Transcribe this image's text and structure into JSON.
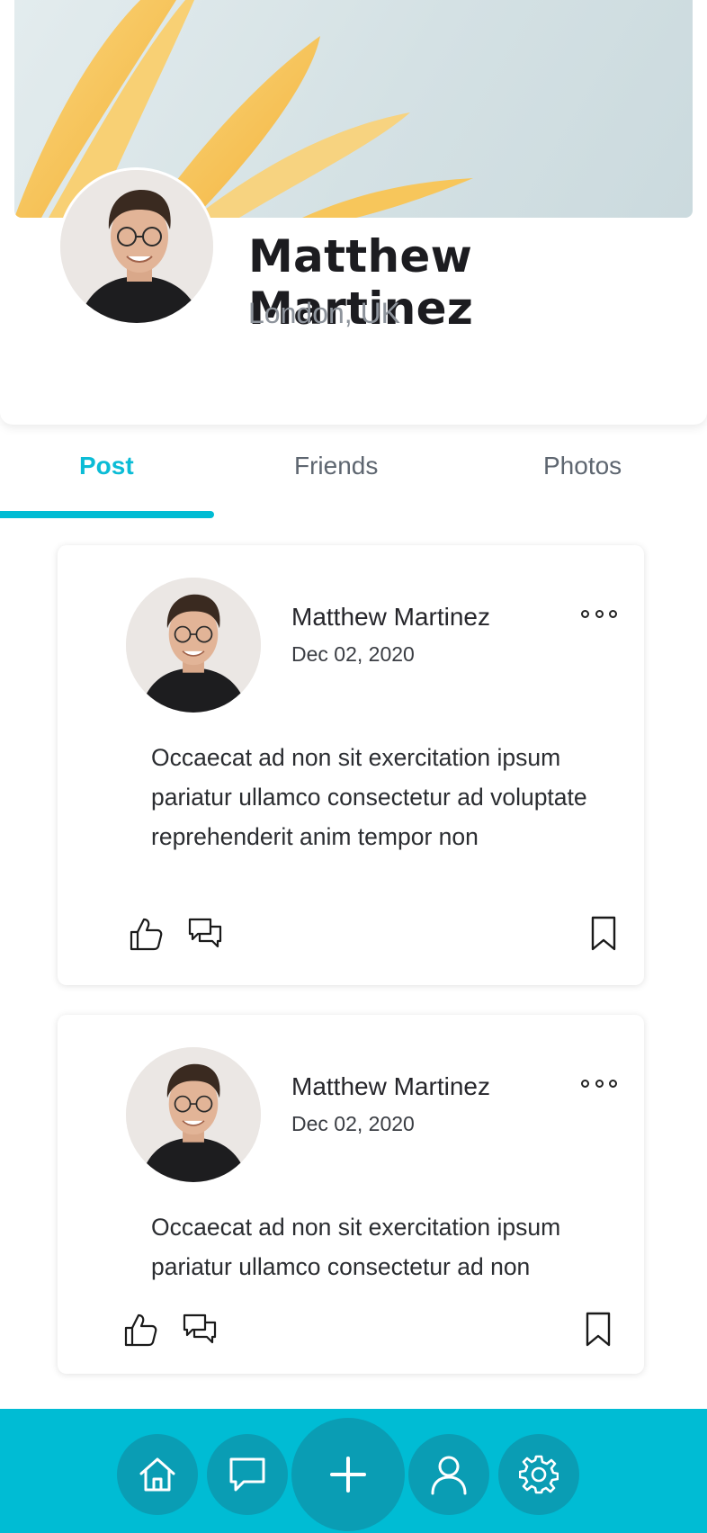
{
  "profile": {
    "name": "Matthew Martinez",
    "location": "London, UK",
    "avatar_icon": "profile-photo",
    "cover_icon": "flower-petals-cover"
  },
  "tabs": [
    {
      "label": "Post",
      "active": true
    },
    {
      "label": "Friends",
      "active": false
    },
    {
      "label": "Photos",
      "active": false
    }
  ],
  "posts": [
    {
      "author": "Matthew Martinez",
      "date": "Dec 02, 2020",
      "text": "Occaecat ad non sit exercitation ipsum pariatur ullamco consectetur ad voluptate reprehenderit anim tempor non"
    },
    {
      "author": "Matthew Martinez",
      "date": "Dec 02, 2020",
      "text": "Occaecat ad non sit exercitation ipsum pariatur ullamco consectetur ad non"
    }
  ],
  "bottom_nav": [
    "home-icon",
    "chat-icon",
    "plus-icon",
    "user-icon",
    "settings-icon"
  ],
  "colors": {
    "accent": "#00bcd4",
    "nav_button": "#0a9db4",
    "petal": "#f7c65b",
    "text_dark": "#1c1c20",
    "text_muted": "#8e949c"
  }
}
